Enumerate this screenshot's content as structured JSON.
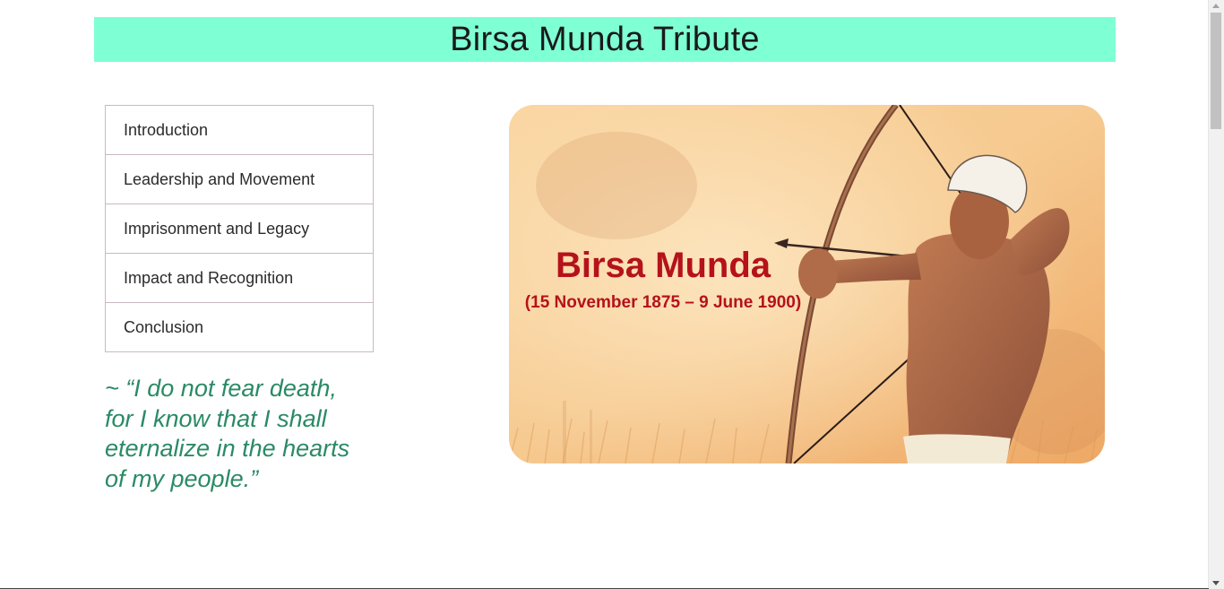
{
  "header": {
    "title": "Birsa Munda Tribute"
  },
  "nav": {
    "items": [
      {
        "label": "Introduction"
      },
      {
        "label": "Leadership and Movement"
      },
      {
        "label": "Imprisonment and Legacy"
      },
      {
        "label": "Impact and Recognition"
      },
      {
        "label": "Conclusion"
      }
    ]
  },
  "quote": {
    "text": "~ “I do not fear death, for I know that I shall eternalize in the hearts of my people.”"
  },
  "hero": {
    "name": "Birsa Munda",
    "dates": "(15 November 1875 – 9 June 1900)",
    "title_color": "#b5121b"
  },
  "colors": {
    "header_bg": "#7fffd4",
    "quote_color": "#2a8a66"
  }
}
